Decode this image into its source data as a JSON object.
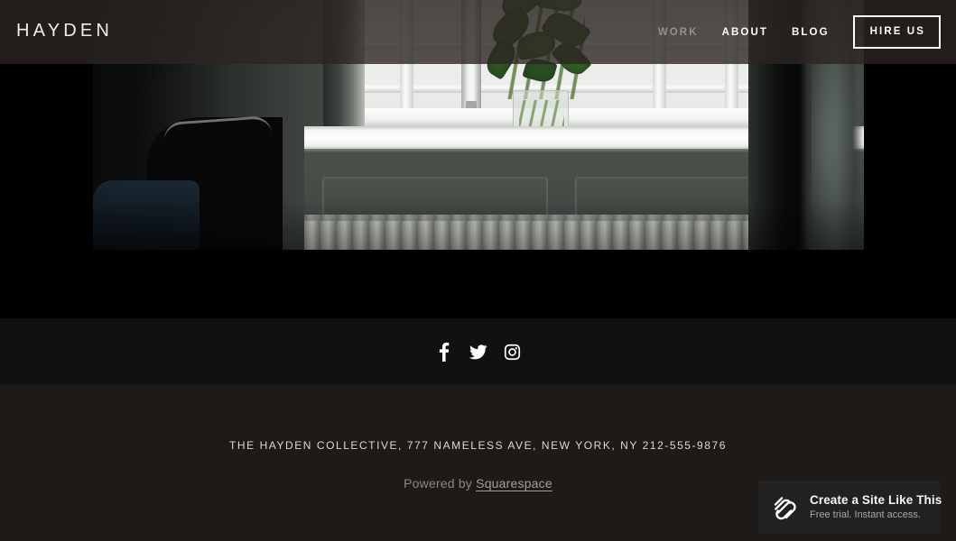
{
  "site": {
    "logo": "HAYDEN"
  },
  "nav": {
    "items": [
      {
        "label": "WORK",
        "state": "dim"
      },
      {
        "label": "ABOUT",
        "state": "active"
      },
      {
        "label": "BLOG",
        "state": "active"
      }
    ],
    "cta_label": "HIRE US"
  },
  "hero": {
    "image_description": "Dark interior photograph of a windowsill with a leafy plant in a clear glass vase, a cast-iron radiator beneath the window and a dark wooden chair at the left",
    "alt": "Windowsill with plant in glass vase"
  },
  "social": {
    "items": [
      {
        "name": "facebook-icon",
        "label": "Facebook"
      },
      {
        "name": "twitter-icon",
        "label": "Twitter"
      },
      {
        "name": "instagram-icon",
        "label": "Instagram"
      }
    ]
  },
  "footer": {
    "address": "THE HAYDEN COLLECTIVE, 777 NAMELESS AVE, NEW YORK, NY   212-555-9876",
    "powered_by_prefix": "Powered by ",
    "powered_by_link": "Squarespace"
  },
  "promo": {
    "title": "Create a Site Like This",
    "subtitle": "Free trial. Instant access.",
    "logo_name": "squarespace-logo-icon"
  },
  "colors": {
    "header_overlay": "#2c2622",
    "page_black": "#000000",
    "social_strip": "#111111",
    "footer_bg": "#1e1a17",
    "promo_bg": "#222222",
    "text_light": "#ffffff",
    "text_muted": "#96908b",
    "footer_text": "#ddd8d2",
    "powered_text": "#8d8781"
  }
}
